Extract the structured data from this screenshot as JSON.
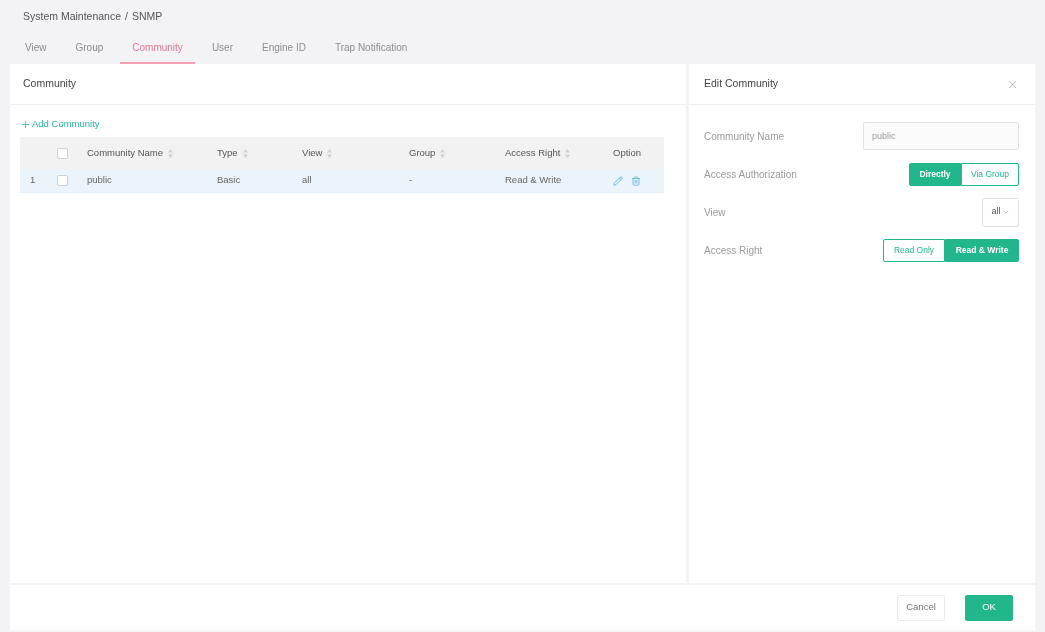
{
  "breadcrumb": {
    "items": [
      "System Maintenance",
      "SNMP"
    ],
    "separator": "/"
  },
  "tabs": [
    {
      "label": "View",
      "selected": false
    },
    {
      "label": "Group",
      "selected": false
    },
    {
      "label": "Community",
      "selected": true
    },
    {
      "label": "User",
      "selected": false
    },
    {
      "label": "Engine ID",
      "selected": false
    },
    {
      "label": "Trap Notification",
      "selected": false
    }
  ],
  "community_panel": {
    "title": "Community",
    "add_button": "Add Community"
  },
  "table": {
    "header_checkbox": {
      "checked": false
    },
    "columns": [
      {
        "label": "Community Name",
        "sortable": true
      },
      {
        "label": "Type",
        "sortable": true
      },
      {
        "label": "View",
        "sortable": true
      },
      {
        "label": "Group",
        "sortable": true
      },
      {
        "label": "Access Right",
        "sortable": true
      },
      {
        "label": "Option",
        "sortable": false
      }
    ],
    "rows": [
      {
        "index": "1",
        "checked": false,
        "selected": true,
        "cells": [
          "public",
          "Basic",
          "all",
          "-",
          "Read & Write"
        ]
      }
    ]
  },
  "edit_panel": {
    "title": "Edit Community",
    "fields": [
      {
        "kind": "text",
        "label": "Community Name",
        "value": "public",
        "disabled": true
      },
      {
        "kind": "segmented",
        "label": "Access Authorization",
        "options": [
          {
            "label": "Directly",
            "selected": true
          },
          {
            "label": "Via Group",
            "selected": false
          }
        ]
      },
      {
        "kind": "select",
        "label": "View",
        "value": "all"
      },
      {
        "kind": "segmented",
        "label": "Access Right",
        "options": [
          {
            "label": "Read Only",
            "selected": false
          },
          {
            "label": "Read & Write",
            "selected": true
          }
        ]
      }
    ]
  },
  "footer": {
    "buttons": [
      {
        "label": "Cancel",
        "kind": "secondary"
      },
      {
        "label": "OK",
        "kind": "primary"
      }
    ]
  }
}
